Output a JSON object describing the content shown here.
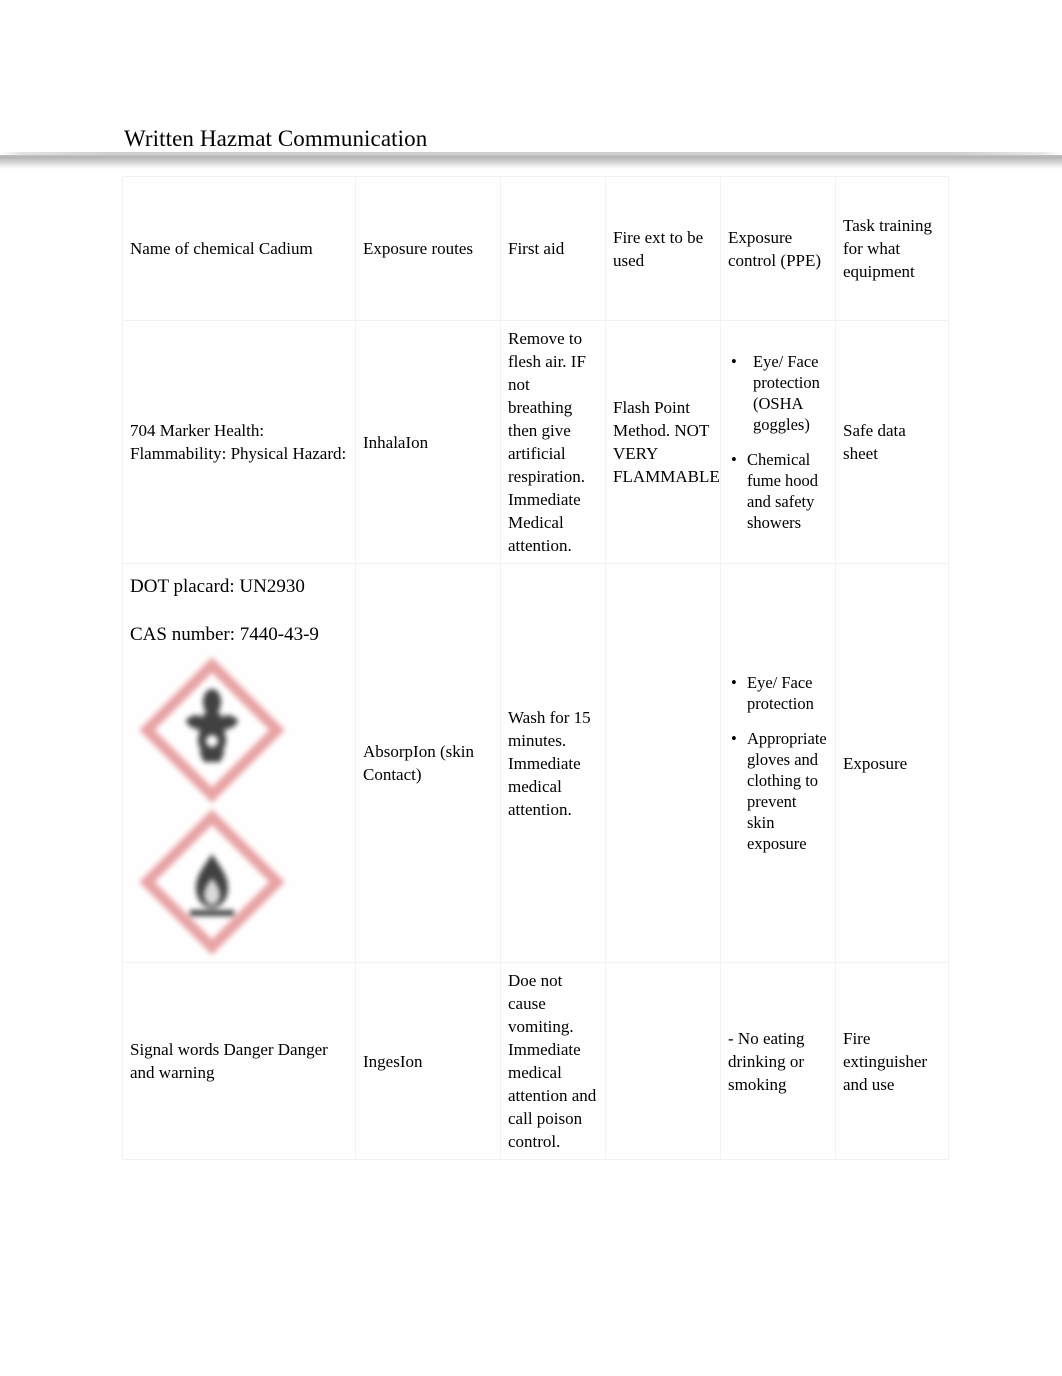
{
  "document": {
    "title": "Written Hazmat Communication"
  },
  "table": {
    "headers": [
      "Name of chemical Cadium",
      "Exposure routes",
      "First aid",
      "Fire ext to be used",
      "Exposure control (PPE)",
      "Task training for what equipment"
    ],
    "rows": [
      {
        "chemical_info": "704 Marker Health: Flammability: Physical Hazard:",
        "exposure_route": "InhalaIon",
        "first_aid": "Remove to flesh air. IF not breathing then give artificial respiration. Immediate Medical attention.",
        "fire_ext": "Flash Point Method. NOT VERY FLAMMABLE",
        "ppe": [
          " Eye/ Face protection (OSHA goggles)",
          "Chemical fume hood and safety showers"
        ],
        "task_training": "Safe data sheet"
      },
      {
        "dot_placard": "DOT placard: UN2930",
        "cas_number": "CAS number: 7440-43-9",
        "pictograms": [
          {
            "name": "ghs-health-hazard-pictogram",
            "border_color": "#e8a0a0",
            "symbol_color": "#3a3a3a"
          },
          {
            "name": "ghs-flame-pictogram",
            "border_color": "#e8a0a0",
            "symbol_color": "#3a3a3a"
          }
        ],
        "exposure_route": "AbsorpIon (skin Contact)",
        "first_aid": "Wash for 15 minutes. Immediate medical attention.",
        "fire_ext": "",
        "ppe": [
          "Eye/ Face protection",
          "Appropriate gloves and clothing to prevent skin exposure"
        ],
        "task_training": "Exposure"
      },
      {
        "chemical_info": "Signal words Danger Danger and warning",
        "exposure_route": "IngesIon",
        "first_aid": "Doe not cause vomiting. Immediate medical attention and call poison control.",
        "fire_ext": "",
        "ppe_plain": "- No eating drinking or smoking",
        "task_training": "Fire extinguisher and use"
      }
    ]
  },
  "colors": {
    "text": "#000000",
    "table_border": "#f2f2f4",
    "rule_gray": "#b4b4b4",
    "pictogram_red": "#e8a0a0"
  }
}
